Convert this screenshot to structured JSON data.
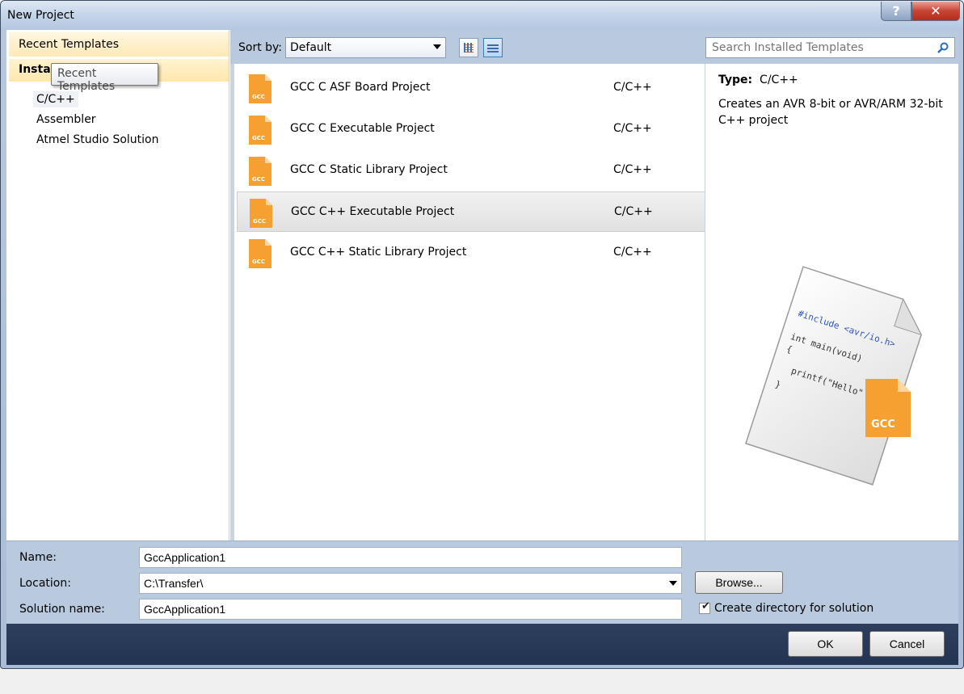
{
  "window": {
    "title": "New Project",
    "help_label": "?",
    "close_label": "✕"
  },
  "left": {
    "recent_templates": "Recent Templates",
    "installed_header": "Instal",
    "tooltip": "Recent Templates",
    "tree": [
      {
        "label": "C/C++",
        "selected": true
      },
      {
        "label": "Assembler",
        "selected": false
      },
      {
        "label": "Atmel Studio Solution",
        "selected": false
      }
    ]
  },
  "toolbar": {
    "sort_label": "Sort by:",
    "sort_value": "Default"
  },
  "search": {
    "placeholder": "Search Installed Templates"
  },
  "templates": [
    {
      "name": "GCC C ASF Board Project",
      "lang": "C/C++",
      "icon": "gcc-file-icon"
    },
    {
      "name": "GCC C Executable Project",
      "lang": "C/C++",
      "icon": "gcc-file-icon"
    },
    {
      "name": "GCC C Static Library Project",
      "lang": "C/C++",
      "icon": "gcc-file-icon"
    },
    {
      "name": "GCC C++ Executable Project",
      "lang": "C/C++",
      "icon": "gcc-file-icon",
      "selected": true
    },
    {
      "name": "GCC C++ Static Library Project",
      "lang": "C/C++",
      "icon": "gcc-file-icon"
    }
  ],
  "template_icon_label": "GCC",
  "details": {
    "type_label": "Type:",
    "type_value": "C/C++",
    "description": "Creates an AVR 8-bit or AVR/ARM 32-bit C++ project",
    "preview_code": [
      "#include <avr/io.h>",
      "int main(void)",
      "{",
      "printf(\"Hello\"",
      "}"
    ],
    "preview_badge": "GCC"
  },
  "form": {
    "name_label": "Name:",
    "name_value": "GccApplication1",
    "location_label": "Location:",
    "location_value": "C:\\Transfer\\",
    "solution_label": "Solution name:",
    "solution_value": "GccApplication1",
    "browse_label": "Browse...",
    "create_dir_label": "Create directory for solution",
    "create_dir_checked": true
  },
  "buttons": {
    "ok": "OK",
    "cancel": "Cancel"
  }
}
